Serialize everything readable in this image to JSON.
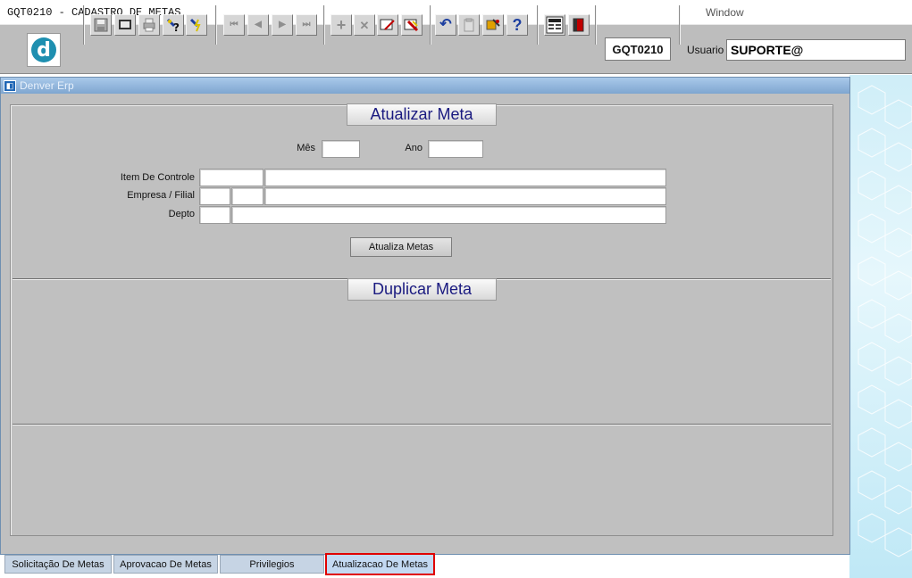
{
  "app": {
    "title": "GQT0210 - CADASTRO DE METAS",
    "menu_window": "Window",
    "window_title": "Denver Erp"
  },
  "toolbar": {
    "form_code": "GQT0210",
    "user_label": "Usuario",
    "user_value": "SUPORTE@",
    "buttons": [
      "save-icon",
      "screen-icon",
      "print-icon",
      "help-query-icon",
      "query-execute-icon",
      "first-record-icon",
      "previous-record-icon",
      "next-record-icon",
      "last-record-icon",
      "insert-record-icon",
      "delete-record-icon",
      "edit-record-icon",
      "clear-icon",
      "undo-icon",
      "paste-icon",
      "tools-icon",
      "help-icon",
      "menu-icon",
      "exit-icon"
    ],
    "button_glyphs": {
      "first": "⏮",
      "prev": "◀",
      "next": "▶",
      "last": "⏭",
      "insert": "+",
      "delete": "✕",
      "undo": "↶",
      "help": "?"
    }
  },
  "form": {
    "section1_title": "Atualizar Meta",
    "mes_label": "Mês",
    "ano_label": "Ano",
    "item_label": "Item De Controle",
    "empresa_label": "Empresa / Filial",
    "depto_label": "Depto",
    "update_button": "Atualiza Metas",
    "section2_title": "Duplicar Meta"
  },
  "tabs": [
    {
      "label": "Solicitação De Metas",
      "active": false
    },
    {
      "label": "Aprovacao De Metas",
      "active": false
    },
    {
      "label": "Privilegios",
      "active": false
    },
    {
      "label": "Atualizacao De Metas",
      "active": true
    }
  ],
  "colors": {
    "accent": "#1e8fb0",
    "section_title_text": "#1a1a80",
    "active_tab_highlight": "#e00000"
  }
}
